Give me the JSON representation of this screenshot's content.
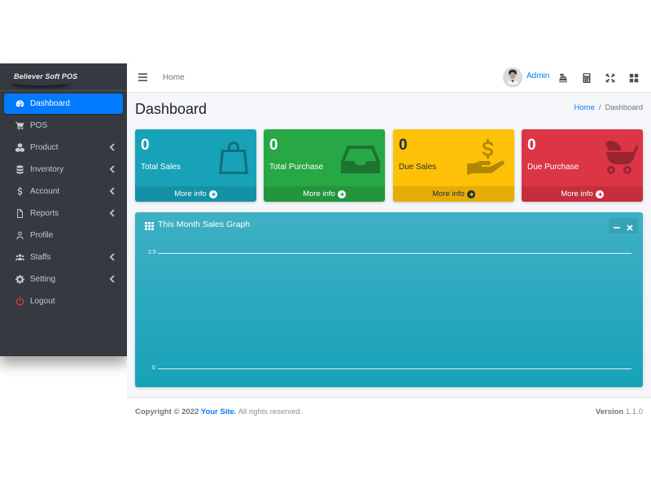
{
  "brand": {
    "name": "Believer Soft POS"
  },
  "sidebar": {
    "items": [
      {
        "label": "Dashboard",
        "icon": "tachometer-icon",
        "active": true,
        "expandable": false
      },
      {
        "label": "POS",
        "icon": "cart-icon",
        "active": false,
        "expandable": false
      },
      {
        "label": "Product",
        "icon": "cubes-icon",
        "active": false,
        "expandable": true
      },
      {
        "label": "Inventory",
        "icon": "database-icon",
        "active": false,
        "expandable": true
      },
      {
        "label": "Account",
        "icon": "dollar-icon",
        "active": false,
        "expandable": true
      },
      {
        "label": "Reports",
        "icon": "file-icon",
        "active": false,
        "expandable": true
      },
      {
        "label": "Profile",
        "icon": "user-icon",
        "active": false,
        "expandable": false
      },
      {
        "label": "Staffs",
        "icon": "users-icon",
        "active": false,
        "expandable": true
      },
      {
        "label": "Setting",
        "icon": "gear-icon",
        "active": false,
        "expandable": true
      },
      {
        "label": "Logout",
        "icon": "power-icon",
        "active": false,
        "expandable": false
      }
    ]
  },
  "topbar": {
    "home_link": "Home",
    "user_name": "Admin",
    "icons": [
      "cash-register-icon",
      "calculator-icon",
      "fullscreen-icon",
      "apps-grid-icon"
    ]
  },
  "header": {
    "title": "Dashboard",
    "breadcrumb": {
      "home": "Home",
      "separator": "/",
      "current": "Dashboard"
    }
  },
  "stats": [
    {
      "value": "0",
      "label": "Total Sales",
      "icon": "shopping-bag-icon",
      "link": "More info",
      "color": "#17a2b8"
    },
    {
      "value": "0",
      "label": "Total Purchase",
      "icon": "inbox-icon",
      "link": "More info",
      "color": "#28a745"
    },
    {
      "value": "0",
      "label": "Due Sales",
      "icon": "hand-dollar-icon",
      "link": "More info",
      "color": "#ffc107"
    },
    {
      "value": "0",
      "label": "Due Purchase",
      "icon": "baby-carriage-icon",
      "link": "More info",
      "color": "#dc3545"
    }
  ],
  "graph": {
    "title": "This Month Sales Graph",
    "icon": "table-icon",
    "tools": [
      "minimize-icon",
      "close-icon"
    ],
    "y_ticks": [
      "2.5",
      "0"
    ]
  },
  "footer": {
    "copyright_prefix": "Copyright © 2022",
    "site_name": "Your Site.",
    "rights": "All rights reserved.",
    "version_label": "Version",
    "version": "1.1.0"
  },
  "colors": {
    "sidebar_bg": "#343a40",
    "active": "#007bff",
    "link": "#007bff",
    "content_bg": "#f4f6f9"
  }
}
